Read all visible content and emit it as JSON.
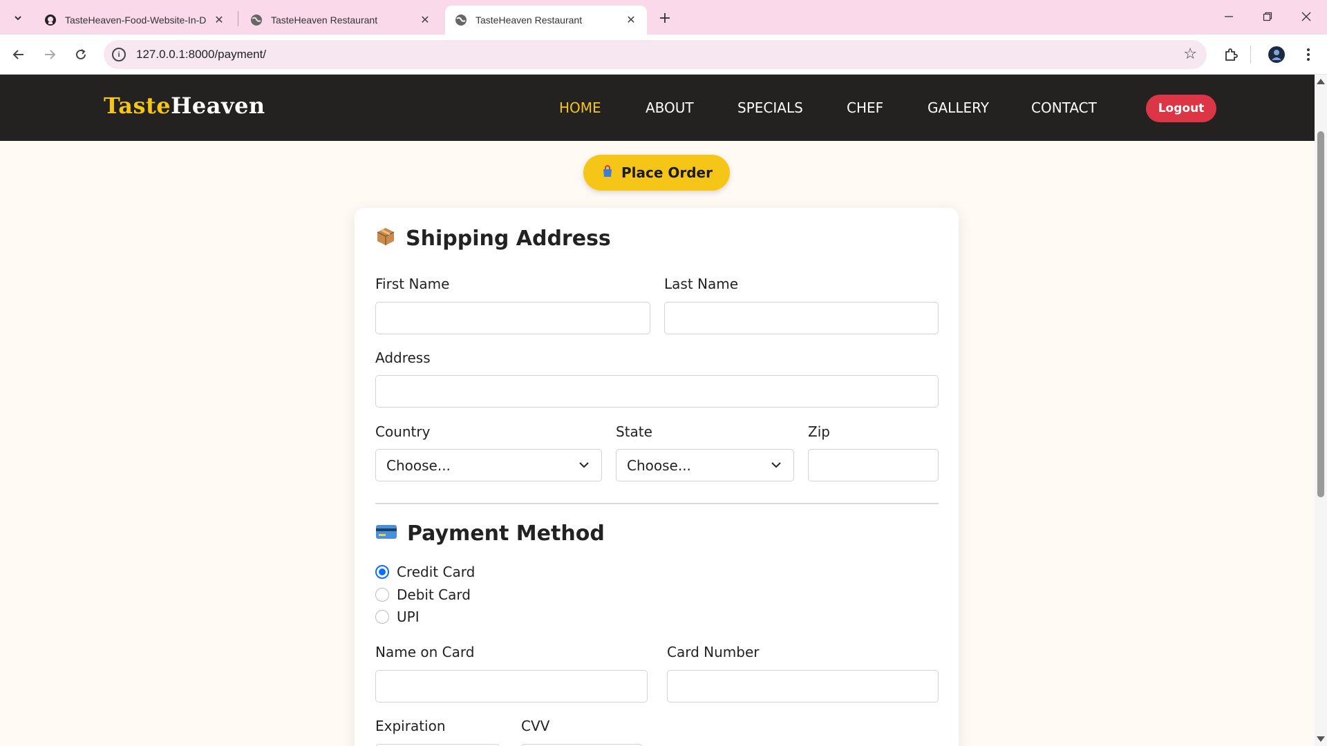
{
  "browser": {
    "tabs": [
      {
        "title": "TasteHeaven-Food-Website-In-D",
        "icon": "github-icon"
      },
      {
        "title": "TasteHeaven Restaurant",
        "icon": "globe-icon"
      },
      {
        "title": "TasteHeaven Restaurant",
        "icon": "globe-icon",
        "active": true
      }
    ],
    "url": "127.0.0.1:8000/payment/"
  },
  "site": {
    "logo_part1": "Taste",
    "logo_part2": "Heaven",
    "nav": [
      "HOME",
      "ABOUT",
      "SPECIALS",
      "CHEF",
      "GALLERY",
      "CONTACT"
    ],
    "active_nav": "HOME",
    "logout_label": "Logout",
    "colors": {
      "accent": "#f5c518",
      "logout": "#dc3545",
      "nav_bg": "#232220",
      "page_bg": "#fffaf3",
      "radio": "#0d6efd"
    }
  },
  "place_order": {
    "icon": "shopping-bag-icon",
    "label": "Place Order"
  },
  "shipping": {
    "title": "Shipping Address",
    "icon": "package-icon",
    "first_name_label": "First Name",
    "last_name_label": "Last Name",
    "address_label": "Address",
    "country_label": "Country",
    "country_value": "Choose...",
    "state_label": "State",
    "state_value": "Choose...",
    "zip_label": "Zip"
  },
  "payment": {
    "title": "Payment Method",
    "icon": "credit-card-icon",
    "methods": [
      "Credit Card",
      "Debit Card",
      "UPI"
    ],
    "selected_method": "Credit Card",
    "name_on_card_label": "Name on Card",
    "card_number_label": "Card Number",
    "expiration_label": "Expiration",
    "cvv_label": "CVV"
  }
}
